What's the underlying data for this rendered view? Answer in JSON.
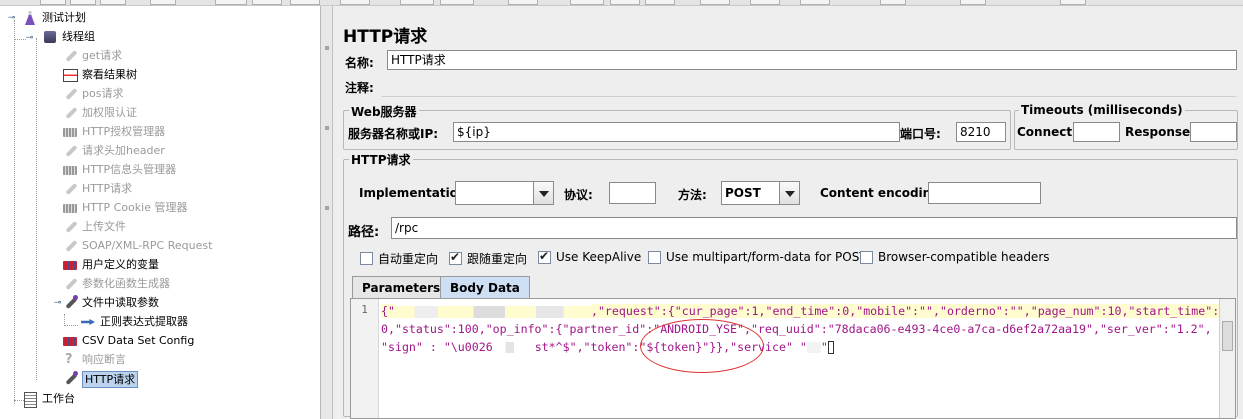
{
  "tree": {
    "root": "测试计划",
    "thread_group": "线程组",
    "items": [
      {
        "label": "get请求",
        "icon": "sampler-icon",
        "enabled": false
      },
      {
        "label": "察看结果树",
        "icon": "results-tree-icon",
        "enabled": true
      },
      {
        "label": "pos请求",
        "icon": "sampler-icon",
        "enabled": false
      },
      {
        "label": "加权限认证",
        "icon": "sampler-icon",
        "enabled": false
      },
      {
        "label": "HTTP授权管理器",
        "icon": "config-icon",
        "enabled": false
      },
      {
        "label": "请求头加header",
        "icon": "sampler-icon",
        "enabled": false
      },
      {
        "label": "HTTP信息头管理器",
        "icon": "config-icon",
        "enabled": false
      },
      {
        "label": "HTTP请求",
        "icon": "sampler-icon",
        "enabled": false
      },
      {
        "label": "HTTP Cookie 管理器",
        "icon": "config-icon",
        "enabled": false
      },
      {
        "label": "上传文件",
        "icon": "sampler-icon",
        "enabled": false
      },
      {
        "label": "SOAP/XML-RPC Request",
        "icon": "sampler-icon",
        "enabled": false
      },
      {
        "label": "用户定义的变量",
        "icon": "config-icon",
        "enabled": true
      },
      {
        "label": "参数化函数生成器",
        "icon": "sampler-icon",
        "enabled": false
      },
      {
        "label": "文件中读取参数",
        "icon": "sampler-icon",
        "enabled": true
      },
      {
        "label": "正则表达式提取器",
        "icon": "extractor-icon",
        "enabled": true
      },
      {
        "label": "CSV Data Set Config",
        "icon": "config-icon",
        "enabled": true
      },
      {
        "label": "响应断言",
        "icon": "assertion-icon",
        "enabled": false
      },
      {
        "label": "HTTP请求",
        "icon": "sampler-icon",
        "enabled": true
      }
    ],
    "workbench": "工作台"
  },
  "panel": {
    "title": "HTTP请求",
    "name_label": "名称:",
    "name_value": "HTTP请求",
    "comment_label": "注释:",
    "web_server_title": "Web服务器",
    "server_label": "服务器名称或IP:",
    "server_value": "${ip}",
    "port_label": "端口号:",
    "port_value": "8210",
    "timeouts_title": "Timeouts (milliseconds)",
    "connect_label": "Connect:",
    "response_label": "Response:",
    "http_request_title": "HTTP请求",
    "impl_label": "Implementation:",
    "protocol_label": "协议:",
    "method_label": "方法:",
    "method_value": "POST",
    "encoding_label": "Content encoding:",
    "path_label": "路径:",
    "path_value": "/rpc",
    "checkboxes": [
      {
        "label": "自动重定向",
        "checked": false
      },
      {
        "label": "跟随重定向",
        "checked": true
      },
      {
        "label": "Use KeepAlive",
        "checked": true
      },
      {
        "label": "Use multipart/form-data for POST",
        "checked": false
      },
      {
        "label": "Browser-compatible headers",
        "checked": false
      }
    ],
    "tabs": [
      "Parameters",
      "Body Data"
    ],
    "active_tab": "Body Data",
    "line_number": "1",
    "body": {
      "line1_a": "{\"",
      "line1_b": ",\"request\":{\"cur_page\":1,\"end_time\":0,\"mobile\":\"\",\"orderno\":\"\",\"page_num\":10,\"start_time\":",
      "line2": "0,\"status\":100,\"op_info\":{\"partner_id\":\"ANDROID_YSE\",\"req_uuid\":\"78daca06-e493-4ce0-a7ca-d6ef2a72aa19\",\"ser_ver\":\"1.2\",",
      "line3_a": "\"sign\" : \"\\u0026",
      "line3_b": "st*^$\",\"token\":\"${token}\"}},\"service\" \"",
      "line3_c": "\""
    }
  }
}
